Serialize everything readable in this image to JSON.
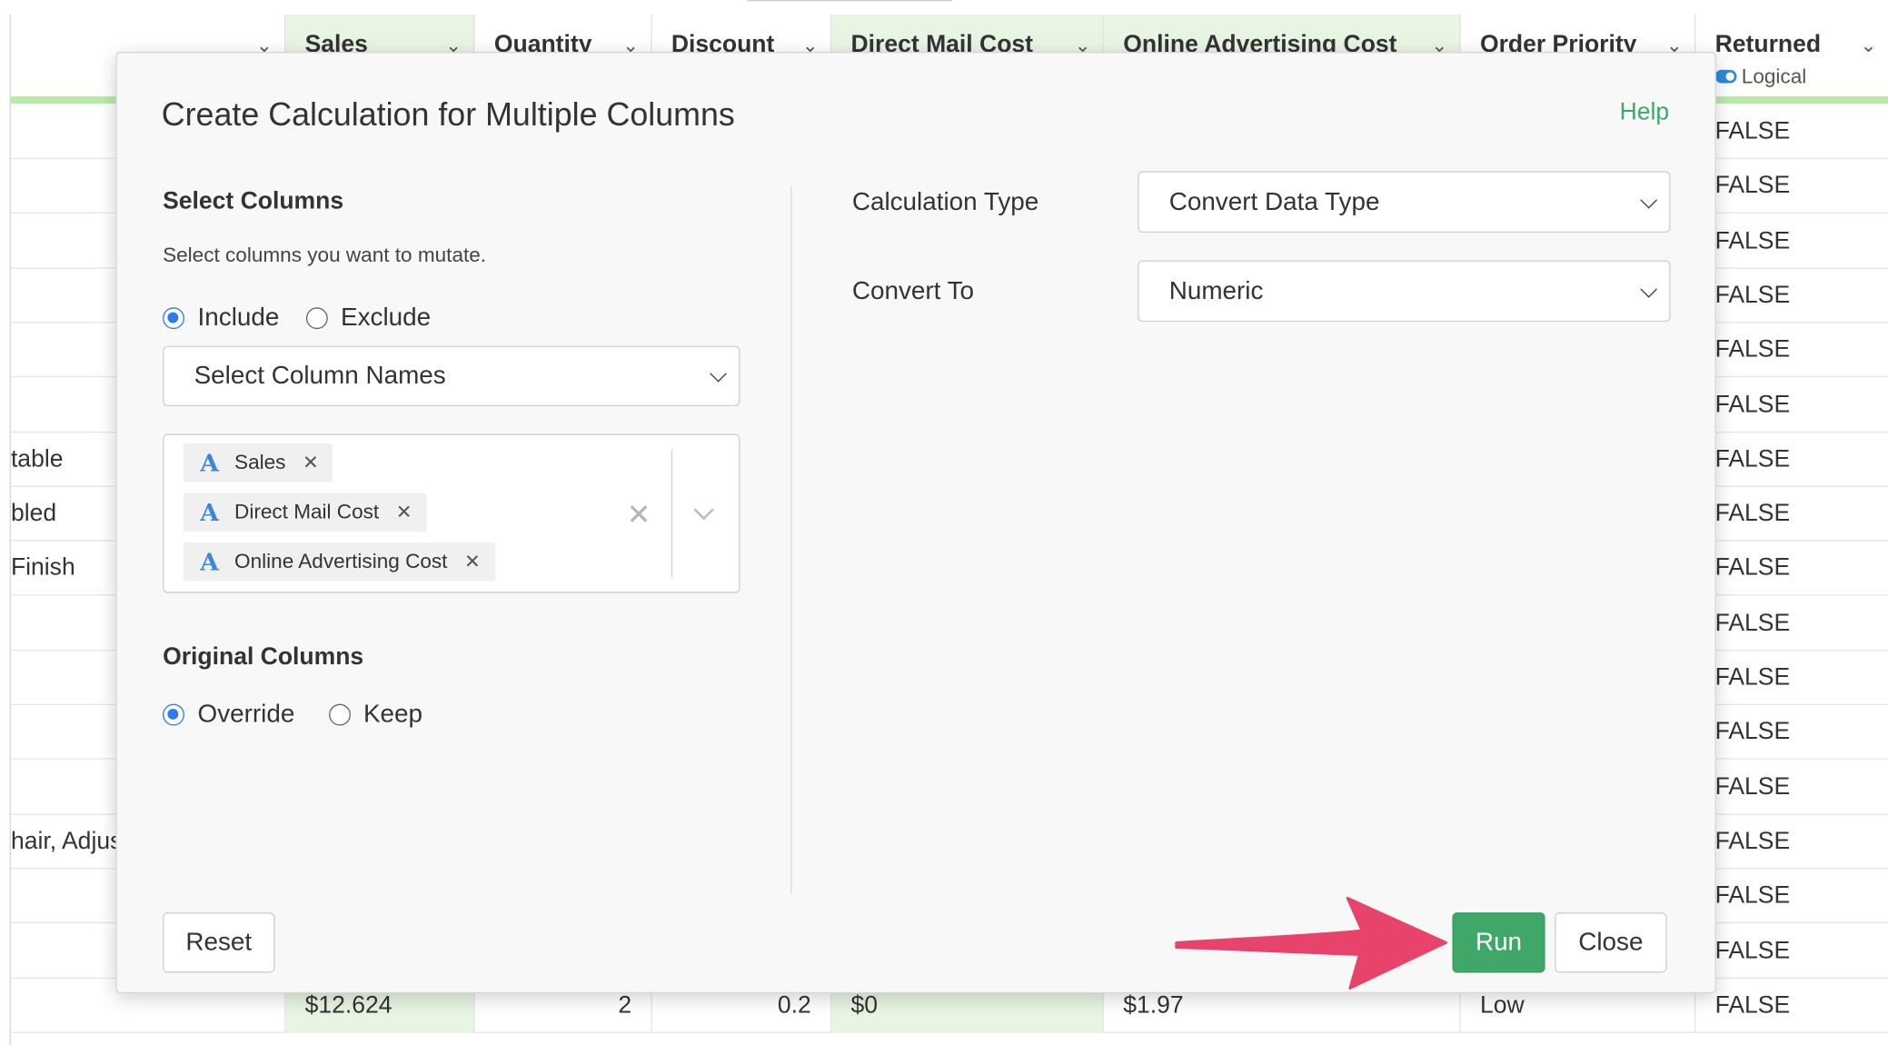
{
  "grid": {
    "columns": [
      {
        "name": "",
        "type": ""
      },
      {
        "name": "Sales",
        "type": ""
      },
      {
        "name": "Quantity",
        "type": ""
      },
      {
        "name": "Discount",
        "type": ""
      },
      {
        "name": "Direct Mail Cost",
        "type": ""
      },
      {
        "name": "Online Advertising Cost",
        "type": ""
      },
      {
        "name": "Order Priority",
        "type": ""
      },
      {
        "name": "Returned",
        "type": "Logical"
      }
    ],
    "left_fragments": [
      "",
      "",
      "",
      "",
      "",
      "",
      "table",
      "bled",
      " Finish",
      "",
      "",
      "",
      "",
      "hair, Adjus",
      "",
      "",
      ""
    ],
    "returned_values": [
      "FALSE",
      "FALSE",
      "FALSE",
      "FALSE",
      "FALSE",
      "FALSE",
      "FALSE",
      "FALSE",
      "FALSE",
      "FALSE",
      "FALSE",
      "FALSE",
      "FALSE",
      "FALSE",
      "FALSE",
      "FALSE",
      "FALSE"
    ],
    "last_row": {
      "sales": "$12.624",
      "quantity": "2",
      "discount": "0.2",
      "direct_mail_cost": "$0",
      "online_advertising_cost": "$1.97",
      "order_priority": "Low"
    }
  },
  "modal": {
    "title": "Create Calculation for Multiple Columns",
    "help": "Help",
    "select_columns": {
      "title": "Select Columns",
      "description": "Select columns you want to mutate.",
      "include_label": "Include",
      "exclude_label": "Exclude",
      "mode": "include",
      "dropdown_value": "Select Column Names",
      "selected": [
        {
          "icon": "A",
          "label": "Sales"
        },
        {
          "icon": "A",
          "label": "Direct Mail Cost"
        },
        {
          "icon": "A",
          "label": "Online Advertising Cost"
        }
      ]
    },
    "original_columns": {
      "title": "Original Columns",
      "override_label": "Override",
      "keep_label": "Keep",
      "mode": "override"
    },
    "calculation_type": {
      "label": "Calculation Type",
      "value": "Convert Data Type"
    },
    "convert_to": {
      "label": "Convert To",
      "value": "Numeric"
    },
    "buttons": {
      "reset": "Reset",
      "run": "Run",
      "close": "Close"
    }
  },
  "colors": {
    "accent_green": "#3fa869",
    "help_green": "#3aaa6a",
    "arrow_pink": "#e8436b",
    "radio_blue": "#2b7de9",
    "type_icon_blue": "#3b86d6"
  },
  "icons": [
    "chevron-down-icon",
    "clear-x-icon",
    "remove-tag-icon",
    "character-type-icon",
    "logical-toggle-icon",
    "arrow-annotation-icon"
  ]
}
